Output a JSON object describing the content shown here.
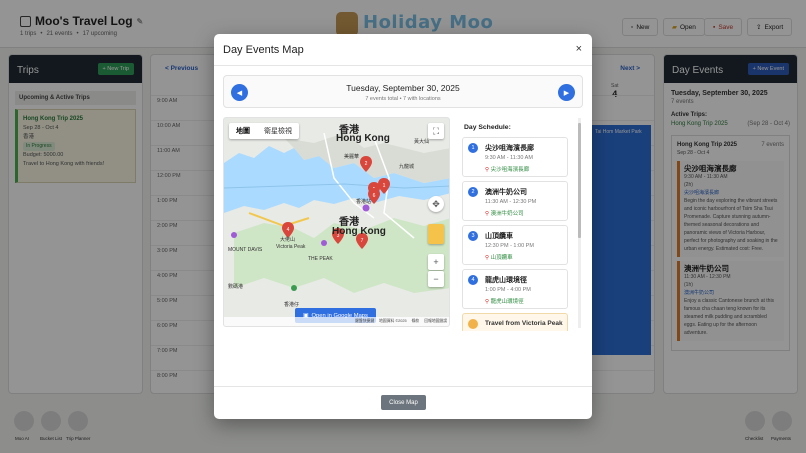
{
  "app": {
    "title": "Moo's Travel Log",
    "stats": [
      "1 trips",
      "•",
      "21 events",
      "•",
      "17 upcoming"
    ],
    "logo_text": "Holiday Moo",
    "toolbar": {
      "new": "New",
      "open": "Open",
      "save": "Save",
      "export": "Export"
    }
  },
  "trips_panel": {
    "title": "Trips",
    "new_trip_label": "+ New Trip",
    "section_label": "Upcoming & Active Trips",
    "trip": {
      "name": "Hong Kong Trip 2025",
      "dates": "Sep 28 - Oct 4",
      "location": "香港",
      "status": "In Progress",
      "budget": "Budget: 5000.00",
      "description": "Travel to Hong Kong with friends!"
    }
  },
  "calendar": {
    "prev_label": "< Previous",
    "next_label": "Next >",
    "day_header": "Sat",
    "day_number": "4",
    "hours": [
      "9:00 AM",
      "10:00 AM",
      "11:00 AM",
      "12:00 PM",
      "1:00 PM",
      "2:00 PM",
      "3:00 PM",
      "4:00 PM",
      "5:00 PM",
      "6:00 PM",
      "7:00 PM",
      "8:00 PM"
    ],
    "blue_event": "Tai Hom Market Park"
  },
  "day_panel": {
    "title": "Day Events",
    "new_event_label": "+ New Event",
    "date": "Tuesday, September 30, 2025",
    "count": "7 events",
    "active_trips_label": "Active Trips:",
    "active_trip_name": "Hong Kong Trip 2025",
    "active_trip_dates": "(Sep 28 - Oct 4)",
    "trip_card_title": "Hong Kong Trip 2025",
    "trip_card_dates": "Sep 28 - Oct 4",
    "trip_card_days": "7 events",
    "events": [
      {
        "name": "尖沙咀海濱長廊",
        "time": "9:30 AM - 11:30 AM",
        "duration": "(2h)",
        "location": "尖沙咀海濱長廊",
        "desc": "Begin the day exploring the vibrant streets and iconic harbourfront of Tsim Sha Tsui Promenade. Capture stunning autumn-themed seasonal decorations and panoramic views of Victoria Harbour, perfect for photography and soaking in the urban energy. Estimated cost: Free."
      },
      {
        "name": "澳洲牛奶公司",
        "time": "11:30 AM - 12:30 PM",
        "duration": "(1h)",
        "location": "澳洲牛奶公司",
        "desc": "Enjoy a classic Cantonese brunch at this famous cha chaan teng known for its steamed milk pudding and scrambled eggs. Eating up for the afternoon adventure."
      }
    ]
  },
  "dock": {
    "left": [
      "Moo AI",
      "Bucket List",
      "Trip Planner"
    ],
    "right": [
      "Checklist",
      "Payments"
    ]
  },
  "modal": {
    "title": "Day Events Map",
    "close_symbol": "×",
    "date": "Tuesday, September 30, 2025",
    "summary": "7 events total • 7 with locations",
    "prev_symbol": "◀",
    "next_symbol": "▶",
    "map": {
      "tab_map": "地圖",
      "tab_satellite": "衛星檢視",
      "city_cn": "香港",
      "city_en": "Hong Kong",
      "labels": [
        "香港站",
        "大佬山",
        "Victoria Peak",
        "MOUNT DAVIS",
        "THE PEAK",
        "數碼港",
        "香港仔",
        "美麗華",
        "黃大仙",
        "九龍城"
      ],
      "footer": [
        "鍵盤快捷鍵",
        "地圖資料 ©2025",
        "條款",
        "回報地圖錯誤"
      ],
      "markers": [
        "1",
        "2",
        "3",
        "4",
        "5",
        "6",
        "7"
      ]
    },
    "open_gmaps_label": "Open in Google Maps",
    "schedule_title": "Day Schedule:",
    "schedule": [
      {
        "num": "1",
        "name": "尖沙咀海濱長廊",
        "time": "9:30 AM - 11:30 AM",
        "location": "尖沙咀海濱長廊"
      },
      {
        "num": "2",
        "name": "澳洲牛奶公司",
        "time": "11:30 AM - 12:30 PM",
        "location": "澳洲牛奶公司"
      },
      {
        "num": "3",
        "name": "山頂纜車",
        "time": "12:30 PM - 1:00 PM",
        "location": "山頂纜車"
      },
      {
        "num": "4",
        "name": "龍虎山環境徑",
        "time": "1:00 PM - 4:00 PM",
        "location": "龍虎山環境徑"
      }
    ],
    "travel_label": "Travel from Victoria Peak",
    "close_button_label": "Close Map",
    "colors": {
      "accent": "#2f6fe0",
      "marker": "#d9463b",
      "location_text": "#2a8a3c"
    }
  }
}
